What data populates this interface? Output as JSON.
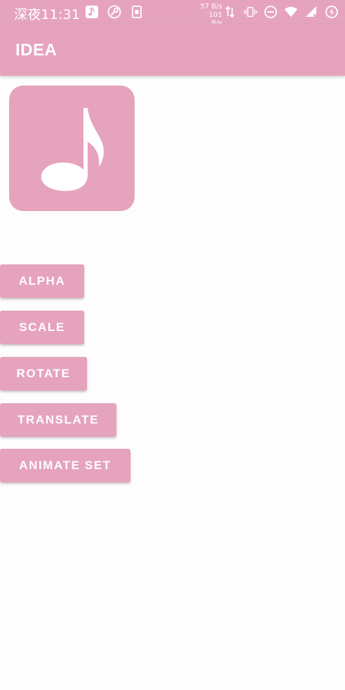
{
  "status_bar": {
    "time": "深夜11:31",
    "net_speed_up": "57 B/s",
    "net_speed_down": "101 B/s",
    "left_icons": [
      "music-note-icon",
      "wrench-icon",
      "sim-card-icon"
    ],
    "right_icons": [
      "data-transfer-icon",
      "vibrate-icon",
      "do-not-disturb-icon",
      "wifi-icon",
      "signal-icon",
      "battery-saver-icon"
    ]
  },
  "app_bar": {
    "title": "IDEA"
  },
  "image": {
    "icon": "music-note-icon"
  },
  "buttons": [
    {
      "label": "ALPHA"
    },
    {
      "label": "SCALE"
    },
    {
      "label": "ROTATE"
    },
    {
      "label": "TRANSLATE"
    },
    {
      "label": "ANIMATE SET"
    }
  ],
  "colors": {
    "accent": "#e6a3bd",
    "on_accent": "#ffffff",
    "background": "#fdfdfd"
  }
}
